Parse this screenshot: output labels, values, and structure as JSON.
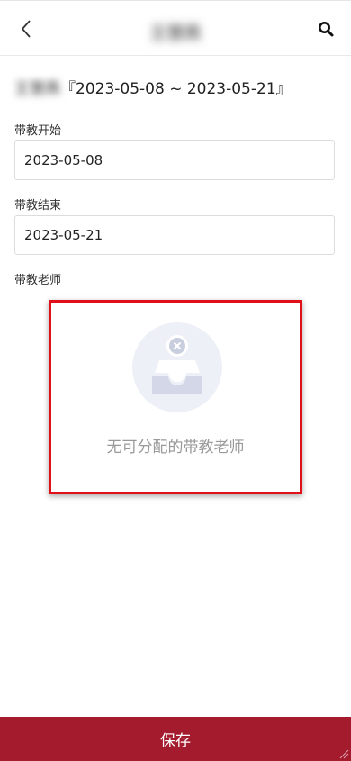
{
  "header": {
    "title": "王慧燕",
    "back_icon": "chevron-left-icon",
    "search_icon": "search-icon"
  },
  "course": {
    "name": "王慧燕",
    "date_range": "『2023-05-08 ~ 2023-05-21』"
  },
  "form": {
    "start": {
      "label": "带教开始",
      "value": "2023-05-08"
    },
    "end": {
      "label": "带教结束",
      "value": "2023-05-21"
    },
    "teacher": {
      "label": "带教老师"
    }
  },
  "empty_state": {
    "icon": "empty-inbox-icon",
    "text": "无可分配的带教老师"
  },
  "footer": {
    "save_label": "保存"
  },
  "colors": {
    "accent": "#a51b2e",
    "highlight_border": "#e0101a"
  }
}
